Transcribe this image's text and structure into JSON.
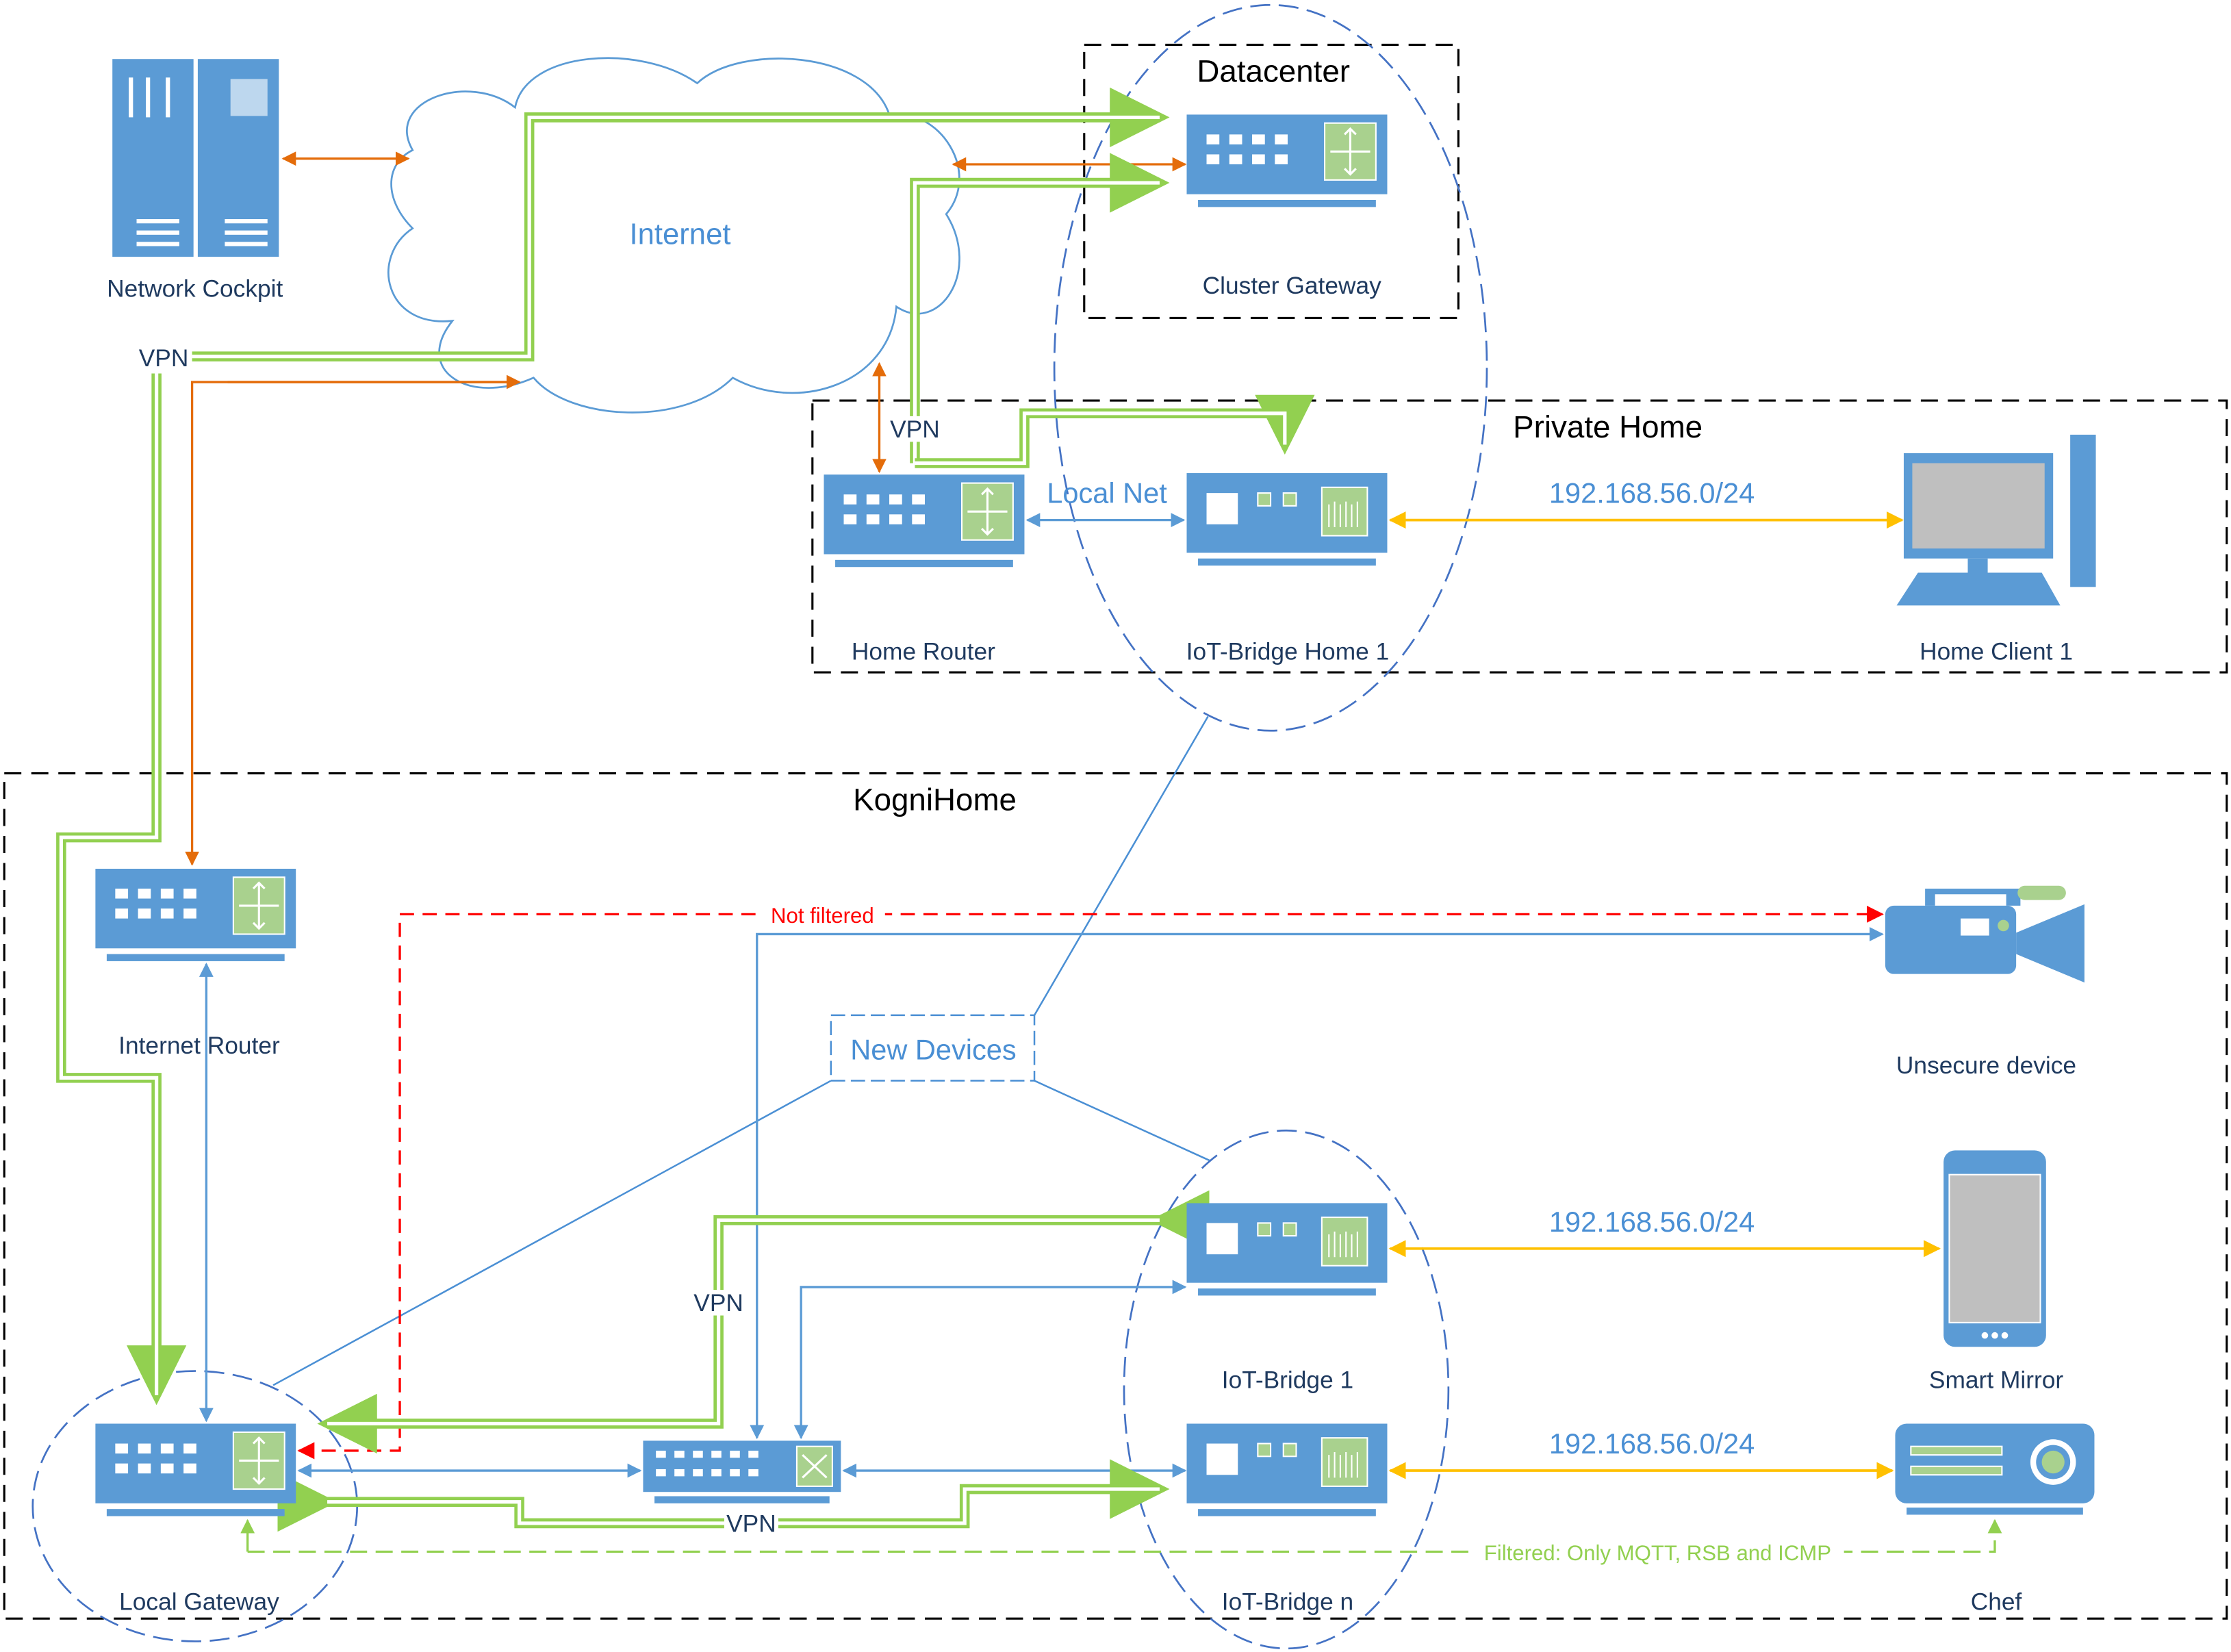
{
  "zones": {
    "datacenter": "Datacenter",
    "private_home": "Private Home",
    "kognihome": "KogniHome"
  },
  "cloud_label": "Internet",
  "devices": {
    "network_cockpit": "Network Cockpit",
    "cluster_gateway": "Cluster Gateway",
    "home_router": "Home Router",
    "iot_bridge_home_1": "IoT-Bridge Home 1",
    "home_client_1": "Home Client 1",
    "internet_router": "Internet Router",
    "unsecure_device": "Unsecure device",
    "iot_bridge_1": "IoT-Bridge 1",
    "smart_mirror": "Smart Mirror",
    "local_gateway": "Local Gateway",
    "iot_bridge_n": "IoT-Bridge n",
    "chef": "Chef"
  },
  "links": {
    "vpn": "VPN",
    "local_net": "Local Net",
    "subnet": "192.168.56.0/24",
    "not_filtered": "Not filtered",
    "filtered": "Filtered: Only MQTT, RSB and ICMP",
    "new_devices": "New Devices"
  },
  "colors": {
    "device": "#5b9bd5",
    "vpn": "#92d050",
    "internet": "#e46c0a",
    "local": "#5b9bd5",
    "subnet": "#ffc000",
    "not_filtered": "#ff0000"
  }
}
